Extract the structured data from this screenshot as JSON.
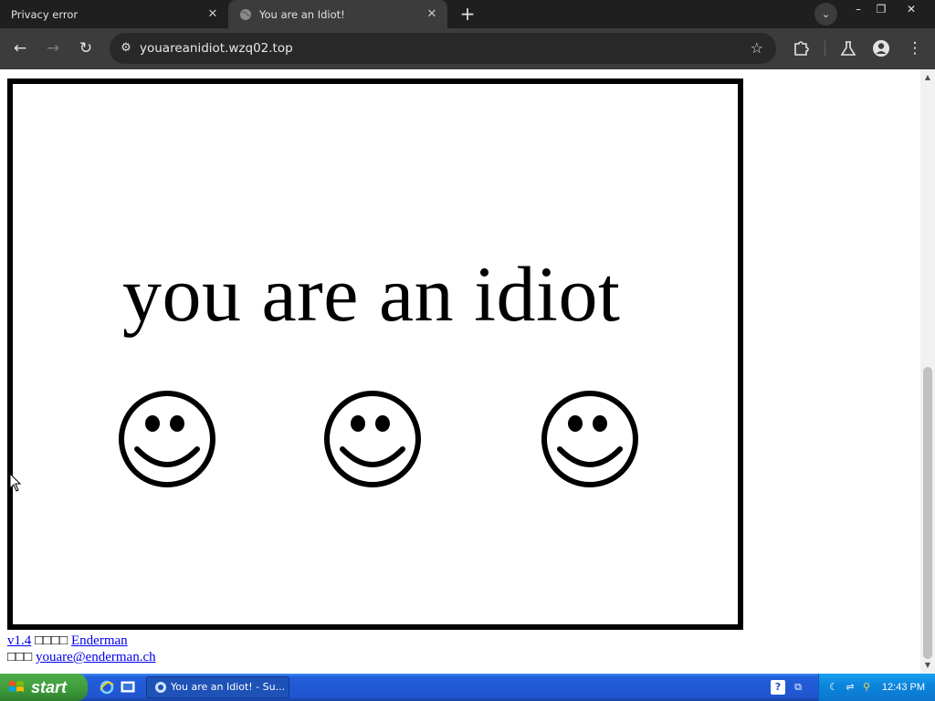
{
  "browser": {
    "tabs": [
      {
        "title": "Privacy error",
        "active": false
      },
      {
        "title": "You are an Idiot!",
        "active": true
      }
    ],
    "url": "youareanidiot.wzq02.top"
  },
  "page": {
    "headline": "you are an idiot",
    "smiley_count": 3,
    "footer": {
      "version_link": "v1.4",
      "line1_glyphs": "□□□□",
      "author_link": "Enderman",
      "line2_glyphs": "□□□",
      "email_link": "youare@enderman.ch"
    }
  },
  "taskbar": {
    "start_label": "start",
    "task_button": "You are an Idiot! - Su...",
    "clock": "12:43 PM"
  },
  "colors": {
    "chrome_dark": "#1f1f1f",
    "chrome_toolbar": "#3c3c3c",
    "link": "#0000ee",
    "xp_blue": "#245edb",
    "xp_green": "#3c9a3a"
  }
}
